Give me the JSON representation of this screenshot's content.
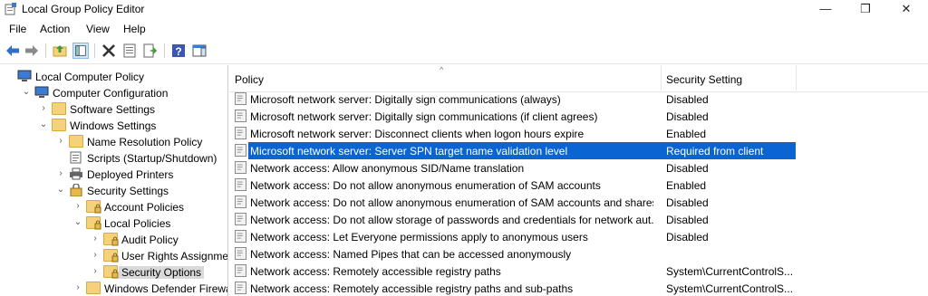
{
  "window": {
    "title": "Local Group Policy Editor",
    "minimize_glyph": "—",
    "maximize_glyph": "❐",
    "close_glyph": "✕"
  },
  "menu": [
    "File",
    "Action",
    "View",
    "Help"
  ],
  "toolbar": {
    "icons": [
      "back-icon",
      "forward-icon",
      "up-folder-icon",
      "show-hide-tree-icon",
      "delete-icon",
      "properties-icon",
      "export-list-icon",
      "help-icon",
      "show-pane-icon"
    ]
  },
  "tree": [
    {
      "label": "Local Computer Policy",
      "level": 0,
      "expander": "",
      "icon": "computer"
    },
    {
      "label": "Computer Configuration",
      "level": 1,
      "expander": "⌄",
      "icon": "computer"
    },
    {
      "label": "Software Settings",
      "level": 2,
      "expander": "›",
      "icon": "folder"
    },
    {
      "label": "Windows Settings",
      "level": 2,
      "expander": "⌄",
      "icon": "folder"
    },
    {
      "label": "Name Resolution Policy",
      "level": 3,
      "expander": "›",
      "icon": "folder"
    },
    {
      "label": "Scripts (Startup/Shutdown)",
      "level": 3,
      "expander": "",
      "icon": "script"
    },
    {
      "label": "Deployed Printers",
      "level": 3,
      "expander": "›",
      "icon": "printer"
    },
    {
      "label": "Security Settings",
      "level": 3,
      "expander": "⌄",
      "icon": "security"
    },
    {
      "label": "Account Policies",
      "level": 4,
      "expander": "›",
      "icon": "folder-lock"
    },
    {
      "label": "Local Policies",
      "level": 4,
      "expander": "⌄",
      "icon": "folder-lock"
    },
    {
      "label": "Audit Policy",
      "level": 5,
      "expander": "›",
      "icon": "folder-lock"
    },
    {
      "label": "User Rights Assignment",
      "level": 5,
      "expander": "›",
      "icon": "folder-lock"
    },
    {
      "label": "Security Options",
      "level": 5,
      "expander": "›",
      "icon": "folder-lock",
      "selected": true
    },
    {
      "label": "Windows Defender Firewall",
      "level": 4,
      "expander": "›",
      "icon": "folder"
    }
  ],
  "list": {
    "columns": {
      "policy": "Policy",
      "setting": "Security Setting"
    },
    "rows": [
      {
        "policy": "Microsoft network server: Digitally sign communications (always)",
        "setting": "Disabled"
      },
      {
        "policy": "Microsoft network server: Digitally sign communications (if client agrees)",
        "setting": "Disabled"
      },
      {
        "policy": "Microsoft network server: Disconnect clients when logon hours expire",
        "setting": "Enabled"
      },
      {
        "policy": "Microsoft network server: Server SPN target name validation level",
        "setting": "Required from client",
        "selected": true
      },
      {
        "policy": "Network access: Allow anonymous SID/Name translation",
        "setting": "Disabled"
      },
      {
        "policy": "Network access: Do not allow anonymous enumeration of SAM accounts",
        "setting": "Enabled"
      },
      {
        "policy": "Network access: Do not allow anonymous enumeration of SAM accounts and shares",
        "setting": "Disabled"
      },
      {
        "policy": "Network access: Do not allow storage of passwords and credentials for network aut...",
        "setting": "Disabled"
      },
      {
        "policy": "Network access: Let Everyone permissions apply to anonymous users",
        "setting": "Disabled"
      },
      {
        "policy": "Network access: Named Pipes that can be accessed anonymously",
        "setting": ""
      },
      {
        "policy": "Network access: Remotely accessible registry paths",
        "setting": "System\\CurrentControlS..."
      },
      {
        "policy": "Network access: Remotely accessible registry paths and sub-paths",
        "setting": "System\\CurrentControlS..."
      }
    ]
  },
  "colors": {
    "selection": "#0a64d2",
    "folder": "#f5d27a",
    "tree_selection": "#d9d9d9"
  }
}
